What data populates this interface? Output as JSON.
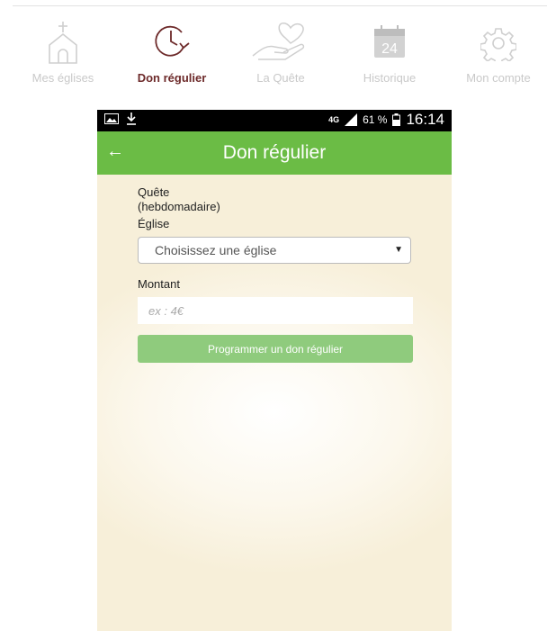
{
  "nav": {
    "items": [
      {
        "label": "Mes églises",
        "icon": "church-icon",
        "active": false
      },
      {
        "label": "Don régulier",
        "icon": "clock-icon",
        "active": true
      },
      {
        "label": "La Quête",
        "icon": "heart-hand-icon",
        "active": false
      },
      {
        "label": "Historique",
        "icon": "calendar-icon",
        "active": false,
        "badge": "24"
      },
      {
        "label": "Mon compte",
        "icon": "gear-icon",
        "active": false
      }
    ]
  },
  "statusbar": {
    "network": "4G",
    "battery": "61 %",
    "time": "16:14"
  },
  "appbar": {
    "back_icon": "←",
    "title": "Don régulier"
  },
  "form": {
    "quete_label_line1": "Quête",
    "quete_label_line2": "(hebdomadaire)",
    "eglise_label": "Église",
    "eglise_select_value": "Choisissez une église",
    "montant_label": "Montant",
    "montant_placeholder": "ex : 4€",
    "submit_label": "Programmer un don régulier"
  },
  "colors": {
    "accent_green": "#6bbc45",
    "button_green": "#8fcb7d",
    "active_nav": "#6d2a2a",
    "inactive_nav": "#c9c9c9"
  }
}
